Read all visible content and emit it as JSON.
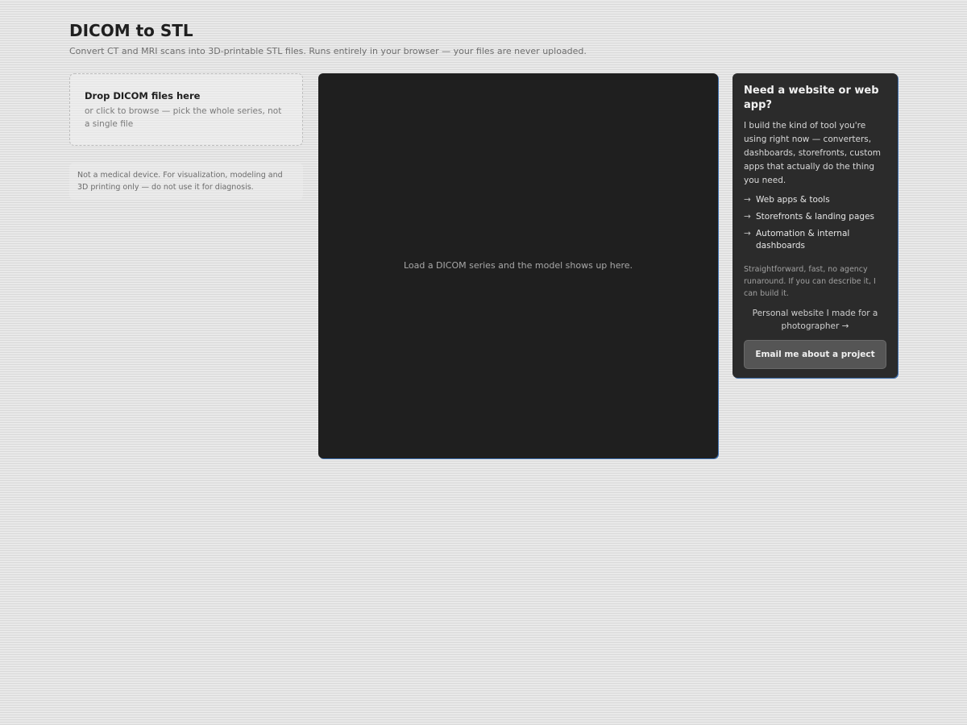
{
  "header": {
    "title": "DICOM to STL",
    "subtitle": "Convert CT and MRI scans into 3D-printable STL files. Runs entirely in your browser — your files are never uploaded."
  },
  "dropzone": {
    "title": "Drop DICOM files here",
    "hint": "or click to browse — pick the whole series, not a single file"
  },
  "disclaimer": "Not a medical device. For visualization, modeling and 3D printing only — do not use it for diagnosis.",
  "viewer": {
    "placeholder": "Load a DICOM series and the model shows up here."
  },
  "promo": {
    "title": "Need a website or web app?",
    "text": "I build the kind of tool you're using right now — converters, dashboards, storefronts, custom apps that actually do the thing you need.",
    "items": [
      {
        "icon": "→",
        "label": "Web apps & tools"
      },
      {
        "icon": "→",
        "label": "Storefronts & landing pages"
      },
      {
        "icon": "→",
        "label": "Automation & internal dashboards"
      }
    ],
    "note": "Straightforward, fast, no agency runaround. If you can describe it, I can build it.",
    "link_label": "Personal website I made for a photographer →",
    "button_label": "Email me about a project"
  },
  "colors": {
    "background": "#e6e6e6",
    "viewer_bg": "#1f1f1f",
    "promo_bg": "#2b2b2b",
    "button_bg": "#555555",
    "accent_edge": "#3d6fae"
  }
}
